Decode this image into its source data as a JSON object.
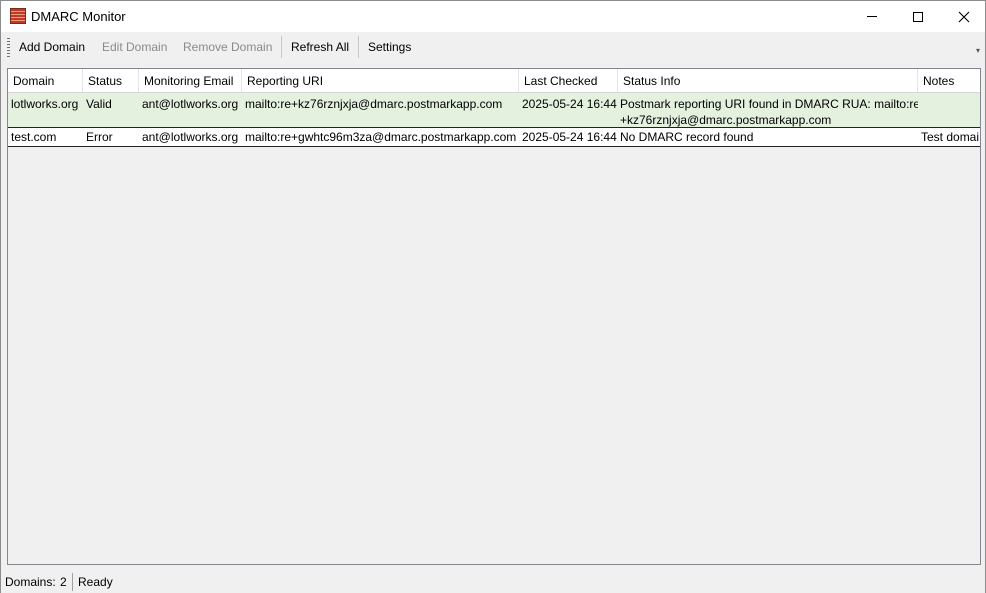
{
  "window": {
    "title": "DMARC Monitor"
  },
  "toolbar": {
    "add_domain": "Add Domain",
    "edit_domain": "Edit Domain",
    "remove_domain": "Remove Domain",
    "refresh_all": "Refresh All",
    "settings": "Settings"
  },
  "grid": {
    "columns": [
      "Domain",
      "Status",
      "Monitoring Email",
      "Reporting URI",
      "Last Checked",
      "Status Info",
      "Notes"
    ],
    "rows": [
      {
        "domain": "lotlworks.org",
        "status": "Valid",
        "monitoring_email": "ant@lotlworks.org",
        "reporting_uri": "mailto:re+kz76rznjxja@dmarc.postmarkapp.com",
        "last_checked": "2025-05-24 16:44",
        "status_info_line1": "Postmark reporting URI found in DMARC RUA: mailto:re",
        "status_info_line2": "+kz76rznjxja@dmarc.postmarkapp.com",
        "notes": ""
      },
      {
        "domain": "test.com",
        "status": "Error",
        "monitoring_email": "ant@lotlworks.org",
        "reporting_uri": "mailto:re+gwhtc96m3za@dmarc.postmarkapp.com",
        "last_checked": "2025-05-24 16:44",
        "status_info_line1": "No DMARC record found",
        "notes": "Test domai"
      }
    ]
  },
  "statusbar": {
    "domains_label": "Domains:",
    "domains_count": "2",
    "state": "Ready"
  },
  "colors": {
    "valid_row": "#e3f1de",
    "disabled_text": "#8a8a8a",
    "border": "#828790"
  }
}
